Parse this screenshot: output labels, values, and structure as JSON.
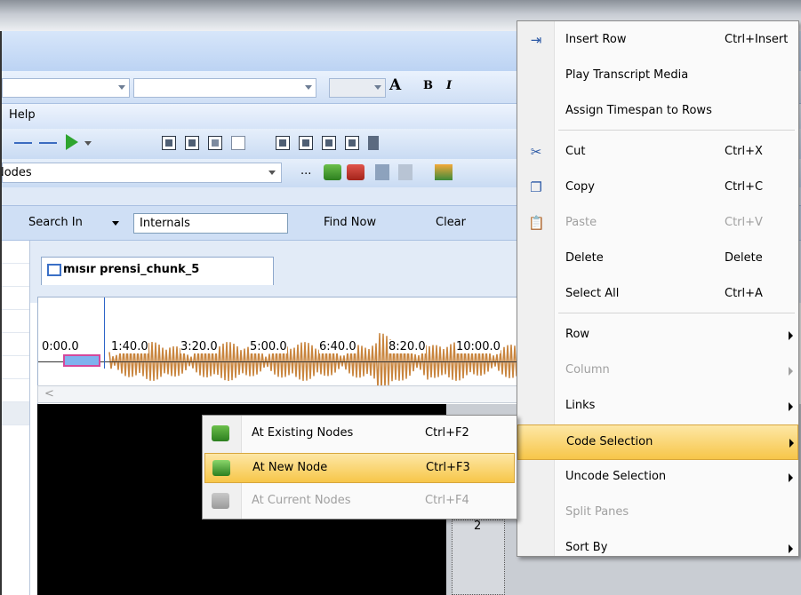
{
  "toolbar": {
    "menu_help": "Help",
    "nodes_label": "Nodes",
    "more": "..."
  },
  "search": {
    "search_in": "Search In",
    "field_value": "Internals",
    "find_now": "Find Now",
    "clear": "Clear"
  },
  "tab": {
    "title": "mısır prensi_chunk_5"
  },
  "timeline": {
    "ticks": [
      "0:00.0",
      "1:40.0",
      "3:20.0",
      "5:00.0",
      "6:40.0",
      "8:20.0",
      "10:00.0"
    ]
  },
  "grid": {
    "row_number": "2"
  },
  "context_menu": {
    "items": [
      {
        "label": "Insert Row",
        "shortcut": "Ctrl+Insert",
        "icon": "insert-row-icon",
        "disabled": false
      },
      {
        "label": "Play Transcript Media",
        "shortcut": "",
        "icon": "",
        "disabled": false
      },
      {
        "label": "Assign Timespan to Rows",
        "shortcut": "",
        "icon": "",
        "disabled": false
      },
      {
        "label": "Cut",
        "shortcut": "Ctrl+X",
        "icon": "scissors-icon",
        "disabled": false
      },
      {
        "label": "Copy",
        "shortcut": "Ctrl+C",
        "icon": "copy-icon",
        "disabled": false
      },
      {
        "label": "Paste",
        "shortcut": "Ctrl+V",
        "icon": "paste-icon",
        "disabled": true
      },
      {
        "label": "Delete",
        "shortcut": "Delete",
        "icon": "",
        "disabled": false
      },
      {
        "label": "Select All",
        "shortcut": "Ctrl+A",
        "icon": "",
        "disabled": false
      },
      {
        "label": "Row",
        "shortcut": "",
        "icon": "",
        "disabled": false,
        "submenu": true
      },
      {
        "label": "Column",
        "shortcut": "",
        "icon": "",
        "disabled": true,
        "submenu": true
      },
      {
        "label": "Links",
        "shortcut": "",
        "icon": "",
        "disabled": false,
        "submenu": true
      },
      {
        "label": "Code Selection",
        "shortcut": "",
        "icon": "",
        "disabled": false,
        "submenu": true,
        "highlighted": true
      },
      {
        "label": "Uncode Selection",
        "shortcut": "",
        "icon": "",
        "disabled": false,
        "submenu": true
      },
      {
        "label": "Split Panes",
        "shortcut": "",
        "icon": "",
        "disabled": true
      },
      {
        "label": "Sort By",
        "shortcut": "",
        "icon": "",
        "disabled": false,
        "submenu": true
      }
    ]
  },
  "submenu": {
    "items": [
      {
        "label": "At Existing Nodes",
        "shortcut": "Ctrl+F2",
        "disabled": false
      },
      {
        "label": "At New Node",
        "shortcut": "Ctrl+F3",
        "disabled": false,
        "highlighted": true
      },
      {
        "label": "At Current Nodes",
        "shortcut": "Ctrl+F4",
        "disabled": true
      }
    ]
  },
  "colors": {
    "highlight": "#f7c649",
    "ribbon": "#cfdff5",
    "waveform": "#c8843d"
  }
}
